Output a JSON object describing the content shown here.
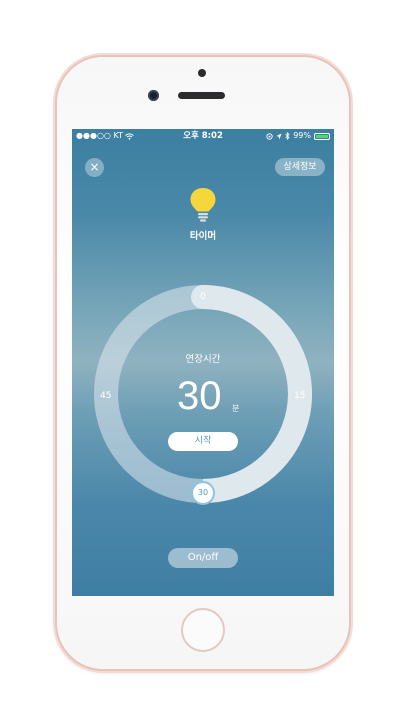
{
  "status_bar": {
    "carrier": "●●●○○ KT",
    "time": "오후 8:02",
    "battery_percent": "99%",
    "battery_level": 0.99,
    "icons": [
      "wifi-icon",
      "location-icon",
      "bluetooth-icon",
      "battery-icon"
    ]
  },
  "header": {
    "close_icon": "×",
    "detail_label": "상세정보"
  },
  "device": {
    "icon": "lightbulb-icon",
    "name": "타이머",
    "bulb_color": "#f5d63b"
  },
  "timer": {
    "title": "연장시간",
    "value": "30",
    "unit": "분",
    "start_label": "시작",
    "dial_labels": {
      "top": "0",
      "right": "15",
      "bottom": "30",
      "left": "45"
    },
    "handle_value": "30",
    "accent_color": "#4b9cc9"
  },
  "footer": {
    "onoff_label": "On/off"
  }
}
